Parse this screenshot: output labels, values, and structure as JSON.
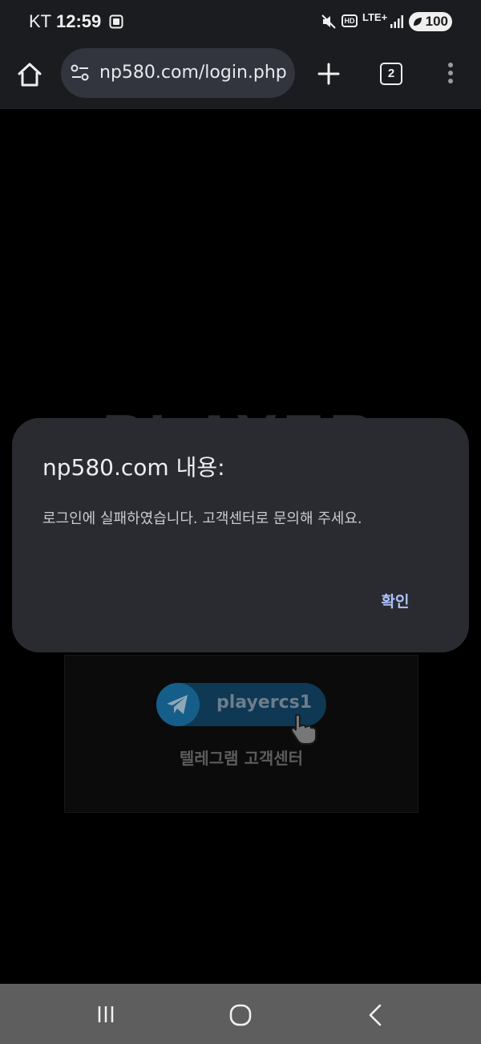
{
  "status_bar": {
    "carrier": "KT",
    "time": "12:59",
    "network": "LTE+",
    "hd_label": "HD",
    "battery": "100",
    "icons": [
      "screenshot-icon",
      "mute-vibrate-icon",
      "hd-voice-icon",
      "lte-plus-icon",
      "signal-icon",
      "battery-saver-icon"
    ]
  },
  "browser": {
    "url": "np580.com/login.php",
    "tab_count": "2",
    "icons": [
      "home-icon",
      "site-info-icon",
      "plus-icon",
      "more-vertical-icon"
    ]
  },
  "page": {
    "logo_text": "PLAYER",
    "telegram_handle": "playercs1",
    "telegram_label": "텔레그램 고객센터",
    "icons": [
      "telegram-icon",
      "hand-pointer-icon"
    ]
  },
  "dialog": {
    "title": "np580.com 내용:",
    "message": "로그인에 실패하였습니다. 고객센터로 문의해 주세요.",
    "confirm_label": "확인",
    "confirm_color": "#aec3ff"
  },
  "nav_bar": {
    "icons": [
      "recent-apps-icon",
      "home-circle-icon",
      "back-icon"
    ]
  },
  "colors": {
    "dialog_bg": "#2a2b30",
    "toolbar_bg": "#1b1c20",
    "url_pill_bg": "#32353e",
    "nav_bar_bg": "#5e5e5e"
  }
}
